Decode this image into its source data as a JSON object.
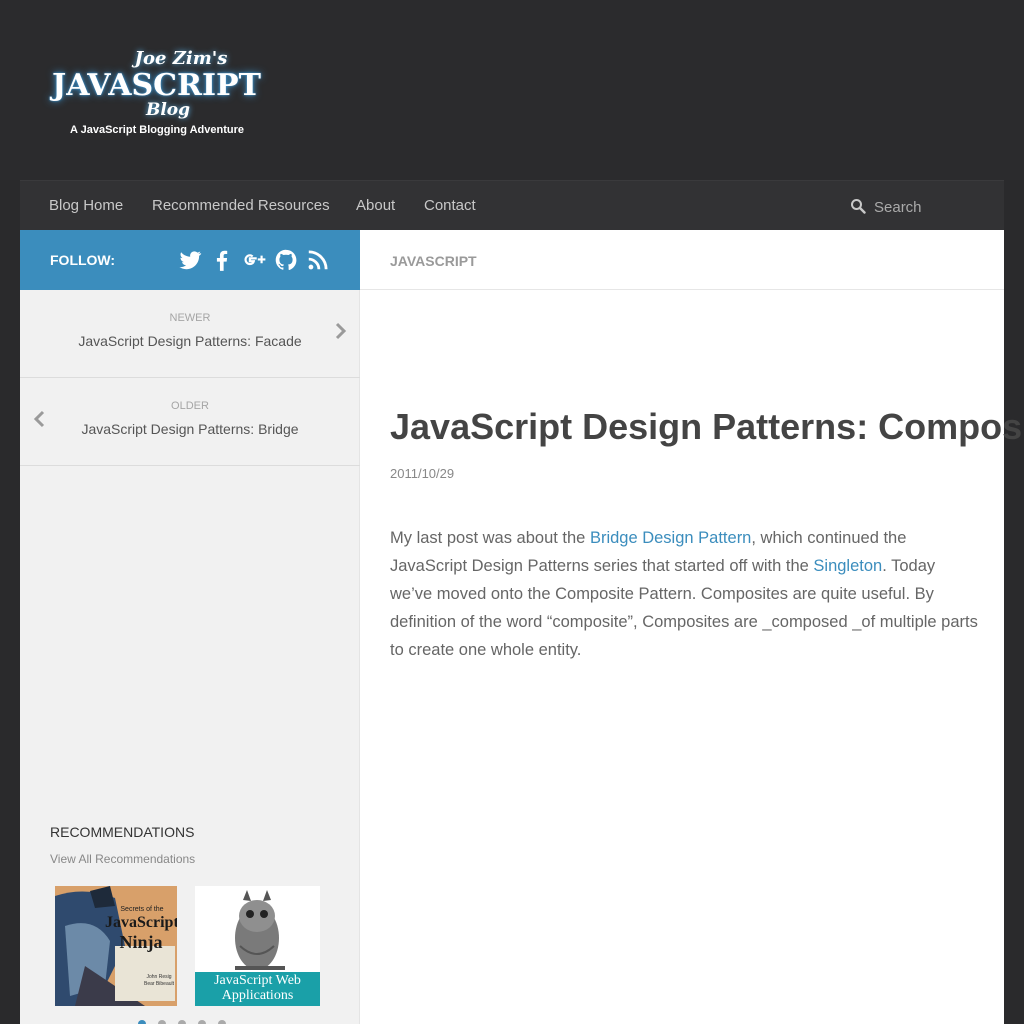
{
  "header": {
    "logo": {
      "line1": "Joe Zim's",
      "line2": "JAVASCRIPT",
      "line3": "Blog",
      "tagline": "A JavaScript Blogging Adventure"
    }
  },
  "nav": {
    "items": [
      {
        "label": "Blog Home"
      },
      {
        "label": "Recommended Resources"
      },
      {
        "label": "About"
      },
      {
        "label": "Contact"
      }
    ],
    "search": {
      "placeholder": "Search",
      "icon": "search-icon"
    }
  },
  "follow": {
    "label": "FOLLOW:",
    "icons": [
      "twitter-icon",
      "facebook-icon",
      "google-plus-icon",
      "github-icon",
      "rss-icon"
    ]
  },
  "category": {
    "label": "JAVASCRIPT"
  },
  "postnav": {
    "newer": {
      "kicker": "NEWER",
      "title": "JavaScript Design Patterns: Facade",
      "icon": "chevron-right-icon"
    },
    "older": {
      "kicker": "OLDER",
      "title": "JavaScript Design Patterns: Bridge",
      "icon": "chevron-left-icon"
    }
  },
  "recommendations": {
    "title": "RECOMMENDATIONS",
    "link": "View All Recommendations",
    "books": [
      {
        "title_line1": "Secrets of the",
        "title_line2": "JavaScript",
        "title_line3": "Ninja",
        "authors_line1": "John Resig",
        "authors_line2": "Bear Bibeault"
      },
      {
        "title_line1": "JavaScript Web",
        "title_line2": "Applications"
      }
    ],
    "active_slide": 1,
    "slide_count": 5
  },
  "post": {
    "title": "JavaScript Design Patterns: Composite",
    "date": "2011/10/29",
    "body": {
      "t1": "My last post was about the ",
      "link1": "Bridge Design Pattern",
      "t2": ", which continued the JavaScript Design Patterns series that started off with the ",
      "link2": "Singleton",
      "t3": ". Today we’ve moved onto the Composite Pattern. Composites are quite useful. By definition of the word “composite”, Composites are _composed _of multiple parts to create one whole entity."
    }
  },
  "colors": {
    "accent": "#3b8dbd",
    "header_bg": "#2b2b2d",
    "nav_bg": "#323234",
    "sidebar_bg": "#f1f1f1"
  }
}
